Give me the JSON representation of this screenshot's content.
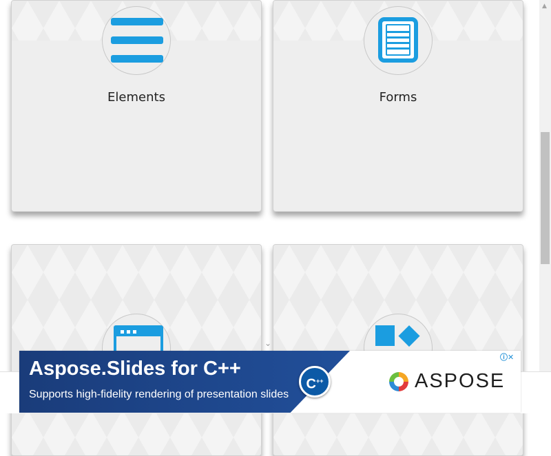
{
  "cards": [
    {
      "title": "Elements",
      "icon": "hamburger-menu-icon"
    },
    {
      "title": "Forms",
      "icon": "document-icon"
    },
    {
      "title": "",
      "icon": "browser-window-icon"
    },
    {
      "title": "",
      "icon": "shapes-icon"
    }
  ],
  "ad": {
    "headline": "Aspose.Slides for C++",
    "subtext": "Supports high-fidelity rendering of presentation slides",
    "cpp_badge": "C",
    "cpp_badge_sup": "++",
    "brand": "ASPOSE",
    "adchoices": "ⓘ✕"
  },
  "colors": {
    "accent": "#1b9de0",
    "card_background": "#eeeeee",
    "ad_blue": "#1a3c7a"
  }
}
